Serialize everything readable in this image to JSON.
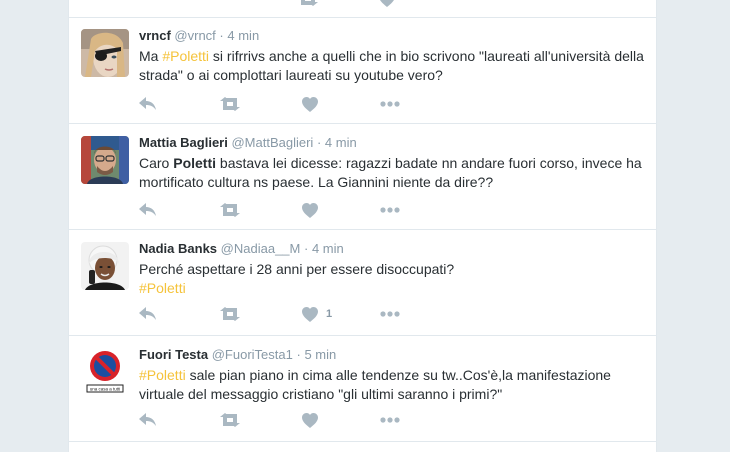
{
  "colors": {
    "hashtag": "#f5c33b",
    "icon": "#aab8c2",
    "muted": "#8899a6",
    "text": "#292f33"
  },
  "tweets": [
    {
      "fullname": "vrncf",
      "username": "@vrncf",
      "time": "4 min",
      "text": [
        {
          "t": "Ma ",
          "s": ""
        },
        {
          "t": "#Poletti",
          "s": "hashtag"
        },
        {
          "t": " si rifrrivs anche a quelli che in bio scrivono \"laureati all'università della strada\" o ai complottari laureati su youtube vero?",
          "s": ""
        }
      ],
      "likes": ""
    },
    {
      "fullname": "Mattia Baglieri",
      "username": "@MattBaglieri",
      "time": "4 min",
      "text": [
        {
          "t": "Caro ",
          "s": ""
        },
        {
          "t": "Poletti",
          "s": "kw"
        },
        {
          "t": " bastava lei dicesse: ragazzi badate nn andare fuori corso, invece ha mortificato cultura ns paese. La Giannini niente da dire??",
          "s": ""
        }
      ],
      "likes": ""
    },
    {
      "fullname": "Nadia Banks",
      "username": "@Nadiaa__M",
      "time": "4 min",
      "text": [
        {
          "t": "Perché aspettare i 28 anni per essere disoccupati?",
          "s": ""
        },
        {
          "t": "\n",
          "s": "br"
        },
        {
          "t": "#Poletti",
          "s": "hashtag"
        }
      ],
      "likes": "1"
    },
    {
      "fullname": "Fuori Testa",
      "username": "@FuoriTesta1",
      "time": "5 min",
      "text": [
        {
          "t": "#Poletti",
          "s": "hashtag"
        },
        {
          "t": " sale pian piano in cima alle tendenze su tw..Cos'è,la manifestazione virtuale del messaggio cristiano \"gli ultimi saranno i primi?\"",
          "s": ""
        }
      ],
      "likes": ""
    }
  ],
  "sign_text": "una casa a tutti"
}
